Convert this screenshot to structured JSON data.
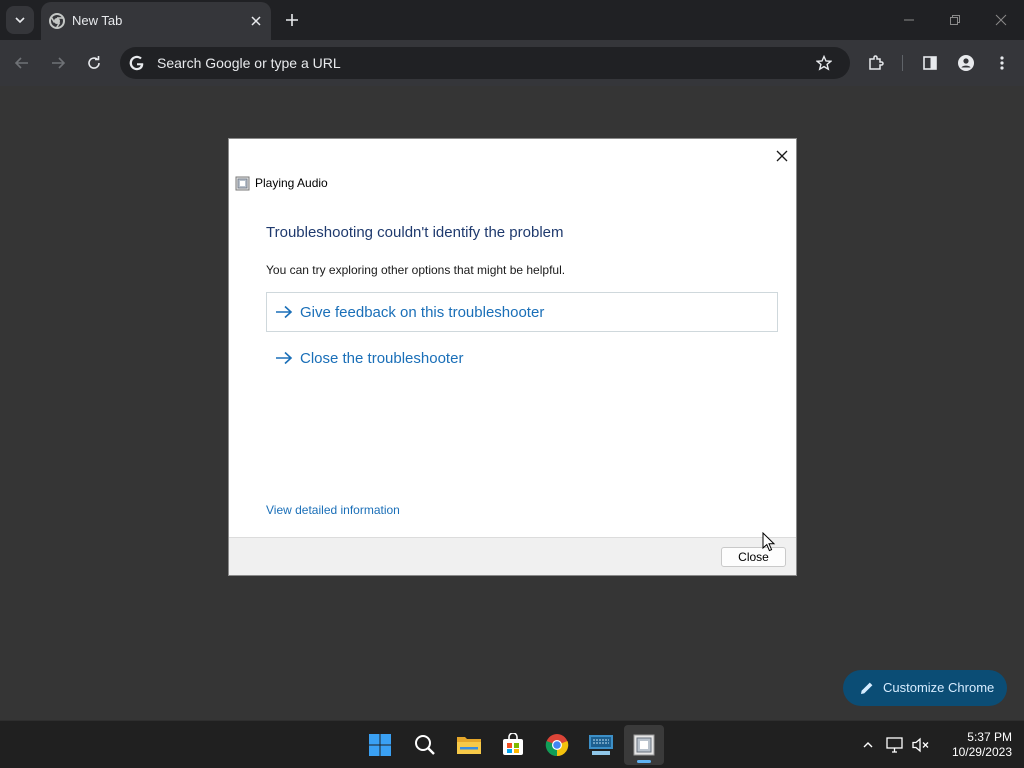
{
  "browser": {
    "tab": {
      "title": "New Tab"
    },
    "omnibox": {
      "placeholder": "Search Google or type a URL"
    },
    "customize_label": "Customize Chrome"
  },
  "dialog": {
    "app_title": "Playing Audio",
    "heading": "Troubleshooting couldn't identify the problem",
    "subtext": "You can try exploring other options that might be helpful.",
    "options": [
      {
        "label": "Give feedback on this troubleshooter"
      },
      {
        "label": "Close the troubleshooter"
      }
    ],
    "details_link": "View detailed information",
    "close_button": "Close"
  },
  "taskbar": {
    "apps": [
      "start-icon",
      "search-icon",
      "file-explorer-icon",
      "store-icon",
      "chrome-icon",
      "touch-keyboard-icon",
      "troubleshooter-icon"
    ],
    "clock": {
      "time": "5:37 PM",
      "date": "10/29/2023"
    }
  },
  "colors": {
    "link_blue": "#1a6fb8",
    "heading_navy": "#1f3a6e",
    "customize_bg": "#0b4d75",
    "page_bg": "#353535"
  }
}
